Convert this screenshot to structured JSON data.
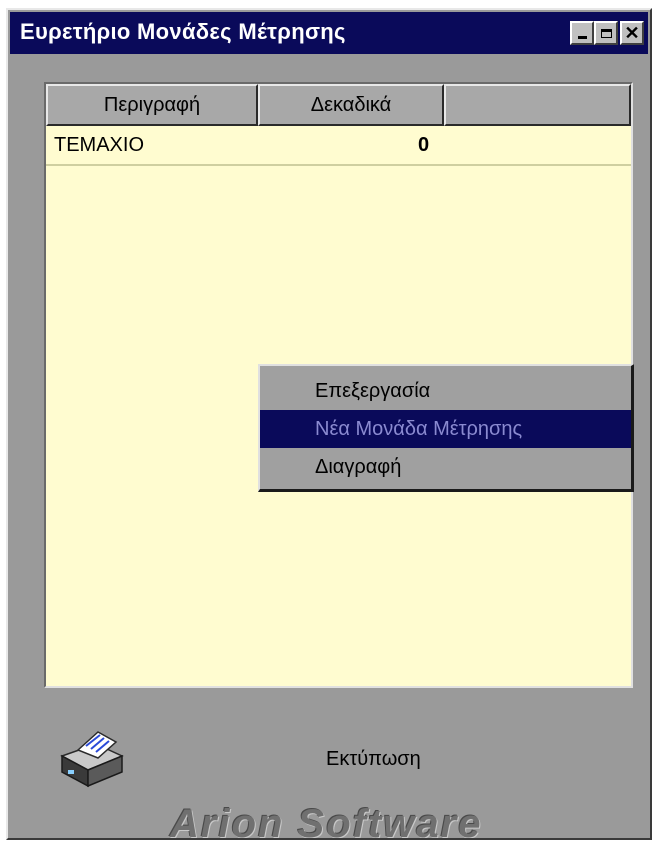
{
  "window": {
    "title": "Ευρετήριο Μονάδες Μέτρησης"
  },
  "table": {
    "columns": [
      "Περιγραφή",
      "Δεκαδικά",
      ""
    ],
    "rows": [
      {
        "description": "ΤΕΜΑΧΙΟ",
        "decimals": "0"
      }
    ]
  },
  "context_menu": {
    "items": [
      "Επεξεργασία",
      "Νέα Μονάδα Μέτρησης",
      "Διαγραφή"
    ],
    "selected_index": 1
  },
  "footer": {
    "print_label": "Εκτύπωση",
    "brand": "Arion Software"
  },
  "colors": {
    "title_bar": "#0a0a5a",
    "grid_background": "#fffcd0",
    "window_background": "#9a9a9a"
  },
  "icons": {
    "printer": "printer-icon",
    "minimize": "minimize-icon",
    "maximize": "maximize-icon",
    "close": "close-icon"
  }
}
